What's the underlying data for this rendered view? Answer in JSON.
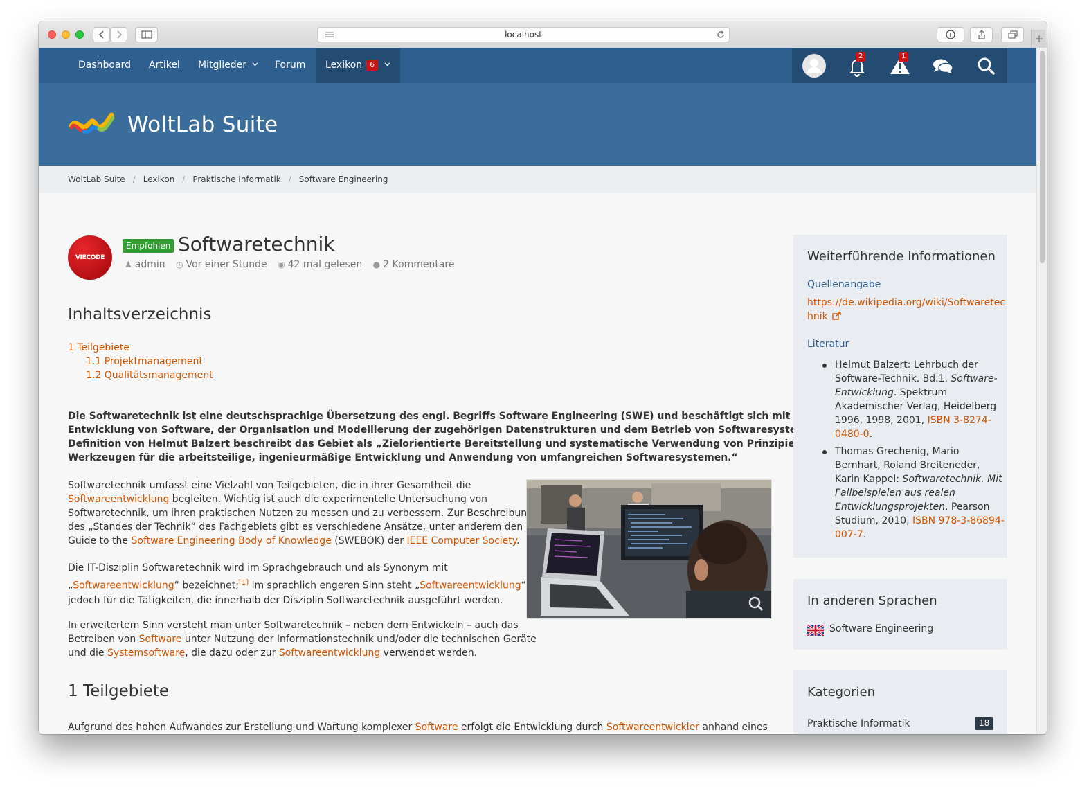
{
  "browser": {
    "url": "localhost"
  },
  "nav": {
    "items": [
      {
        "label": "Dashboard"
      },
      {
        "label": "Artikel"
      },
      {
        "label": "Mitglieder"
      },
      {
        "label": "Forum"
      },
      {
        "label": "Lexikon",
        "badge": "6"
      }
    ],
    "notifications_count": "2",
    "warnings_count": "1",
    "icons": [
      "avatar-icon",
      "bell-icon",
      "warning-icon",
      "chat-icon",
      "search-icon"
    ]
  },
  "header": {
    "logo_text": "WoltLab Suite"
  },
  "breadcrumbs": [
    "WoltLab Suite",
    "Lexikon",
    "Praktische Informatik",
    "Software Engineering"
  ],
  "article": {
    "avatar_text": "VIECODE",
    "badge": "Empfohlen",
    "title": "Softwaretechnik",
    "meta": {
      "author": "admin",
      "time": "Vor einer Stunde",
      "views": "42 mal gelesen",
      "comments": "2 Kommentare"
    },
    "toc_title": "Inhaltsverzeichnis",
    "toc": [
      "1 Teilgebiete",
      "1.1 Projektmanagement",
      "1.2 Qualitätsmanagement"
    ],
    "intro": [
      "Die Softwaretechnik ist eine deutschsprachige Übersetzung des engl. Begriffs Software Engineering (SWE) und beschäftigt sich mit der Herstellung oder",
      "Entwicklung von Software, der Organisation und Modellierung der zugehörigen Datenstrukturen und dem Betrieb von Softwaresystemen. Eine",
      "Definition von Helmut Balzert beschreibt das Gebiet als „Zielorientierte Bereitstellung und systematische Verwendung von Prinzipien, Methoden und",
      "Werkzeugen für die arbeitsteilige, ingenieurmäßige Entwicklung und Anwendung von umfangreichen Softwaresystemen.“"
    ],
    "p1": {
      "t1": "Softwaretechnik umfasst eine Vielzahl von Teilgebieten, die in ihrer Gesamtheit die",
      "l1": "Softwareentwicklung",
      "t2": " begleiten. Wichtig ist auch die experimentelle Untersuchung von",
      "t3": "Softwaretechnik, um ihren praktischen Nutzen zu messen und zu verbessern. Zur Beschreibung",
      "t4": "des „Standes der Technik“ des Fachgebiets gibt es verschiedene Ansätze, unter anderem den",
      "t5": "Guide to the ",
      "l2": "Software Engineering Body of Knowledge",
      "t6": " (SWEBOK) der ",
      "l3": "IEEE Computer Society",
      "t7": "."
    },
    "p2": {
      "t1": "Die IT-Disziplin Softwaretechnik wird im Sprachgebrauch und als Synonym mit",
      "t2": "„",
      "l1": "Softwareentwicklung",
      "t3": "“ bezeichnet;",
      "ref": "[1]",
      "t4": " im sprachlich engeren Sinn steht „",
      "l2": "Softwareentwicklung",
      "t5": "“",
      "t6": "jedoch für die Tätigkeiten, die innerhalb der Disziplin Softwaretechnik ausgeführt werden."
    },
    "p3": {
      "t1": "In erweitertem Sinn versteht man unter Softwaretechnik – neben dem Entwickeln – auch das",
      "t2": "Betreiben von ",
      "l1": "Software",
      "t3": " unter Nutzung der Informationstechnik und/oder die technischen Geräte",
      "t4": "und die ",
      "l2": "Systemsoftware",
      "t5": ", die dazu oder zur ",
      "l3": "Softwareentwicklung",
      "t6": " verwendet werden."
    },
    "section1_title": "1 Teilgebiete",
    "p4": {
      "t1": "Aufgrund des hohen Aufwandes zur Erstellung und Wartung komplexer ",
      "l1": "Software",
      "t2": " erfolgt die Entwicklung durch ",
      "l2": "Softwareentwickler",
      "t3": " anhand eines"
    }
  },
  "sidebar": {
    "info": {
      "title": "Weiterführende Informationen",
      "source_label": "Quellenangabe",
      "source_url_1": "https://de.wikipedia.org/wiki/Softwaretec",
      "source_url_2": "hnik",
      "literature_label": "Literatur",
      "lit1": {
        "a": "Helmut Balzert: Lehrbuch der",
        "b1": "Software-Technik. Bd.1. ",
        "b2": "Software-",
        "c1": "Entwicklung",
        "c2": ". Spektrum",
        "d": "Akademischer Verlag, Heidelberg",
        "e1": "1996, 1998, 2001, ",
        "e2": "ISBN 3-8274-",
        "f1": "0480-0",
        "f2": "."
      },
      "lit2": {
        "a": "Thomas Grechenig, Mario",
        "b": "Bernhart, Roland Breiteneder,",
        "c1": "Karin Kappel: ",
        "c2": "Softwaretechnik. Mit",
        "d": "Fallbeispielen aus realen",
        "e1": "Entwicklungsprojekten",
        "e2": ". Pearson",
        "f1": "Studium, 2010, ",
        "f2": "ISBN 978-3-86894-",
        "g1": "007-7",
        "g2": "."
      }
    },
    "languages": {
      "title": "In anderen Sprachen",
      "entry": "Software Engineering"
    },
    "categories": {
      "title": "Kategorien",
      "entry": "Praktische Informatik",
      "count": "18"
    }
  },
  "colors": {
    "nav": "#2f5f8f",
    "header": "#3a6d9c",
    "link": "#d35400",
    "badge_green": "#2f9d2f",
    "badge_red": "#cc1414"
  }
}
